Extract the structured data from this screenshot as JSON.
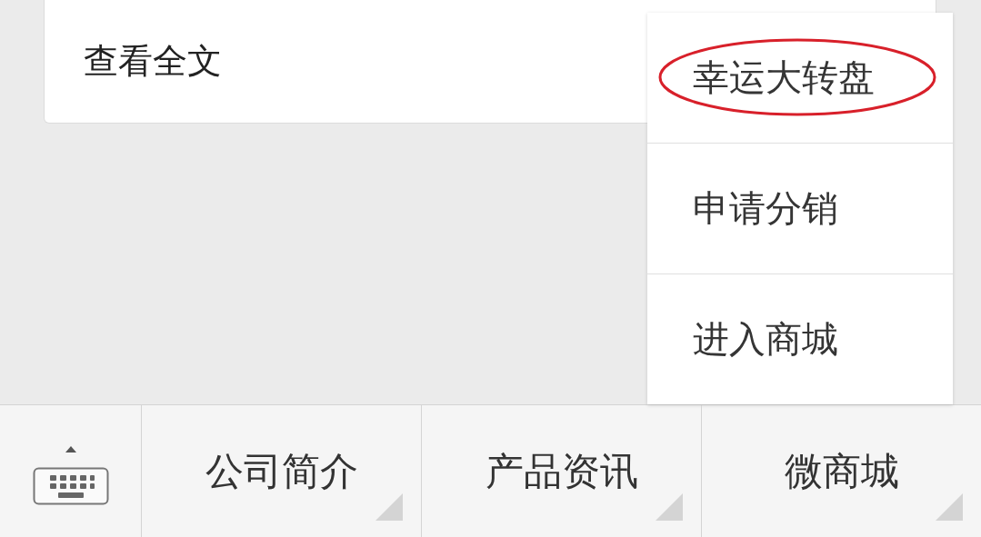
{
  "article_card": {
    "link": "查看全文"
  },
  "popup_menu": {
    "items": [
      {
        "label": "幸运大转盘",
        "highlighted": true
      },
      {
        "label": "申请分销",
        "highlighted": false
      },
      {
        "label": "进入商城",
        "highlighted": false
      }
    ]
  },
  "bottom_menu": {
    "items": [
      {
        "label": "公司简介"
      },
      {
        "label": "产品资讯"
      },
      {
        "label": "微商城"
      }
    ]
  }
}
